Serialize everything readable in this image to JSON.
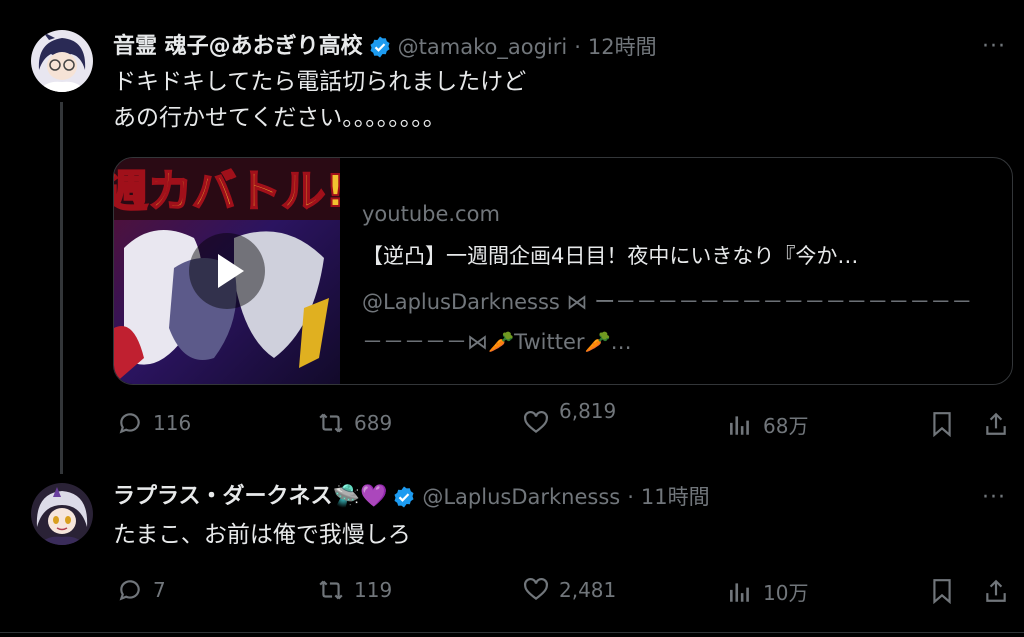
{
  "tweets": [
    {
      "name": "音霊 魂子@あおぎり高校",
      "handle": "@tamako_aogiri",
      "separator": "·",
      "time": "12時間",
      "text": "ドキドキしてたら電話切られましたけど\nあの行かせてください。。。。。。。。",
      "card": {
        "domain": "youtube.com",
        "title": "【逆凸】一週間企画4日目！夜中にいきなり『今か…",
        "description": "@LaplusDarknesss ⋈ ー－－－－－－－－－－－－－－－－－－－－－－⋈🥕Twitter🥕…"
      },
      "stats": {
        "replies": "116",
        "retweets": "689",
        "likes": "6,819",
        "views": "68万"
      }
    },
    {
      "name": "ラプラス・ダークネス🛸💜",
      "handle": "@LaplusDarknesss",
      "separator": "·",
      "time": "11時間",
      "text": "たまこ、お前は俺で我慢しろ",
      "stats": {
        "replies": "7",
        "retweets": "119",
        "likes": "2,481",
        "views": "10万"
      }
    }
  ],
  "more_label": "···",
  "icons": [
    "reply-icon",
    "retweet-icon",
    "like-icon",
    "views-icon",
    "bookmark-icon",
    "share-icon",
    "verified-icon",
    "play-icon"
  ],
  "colors": {
    "background": "#000000",
    "text": "#e7e9ea",
    "muted": "#71767b",
    "verified": "#1d9bf0",
    "border": "#333639"
  }
}
